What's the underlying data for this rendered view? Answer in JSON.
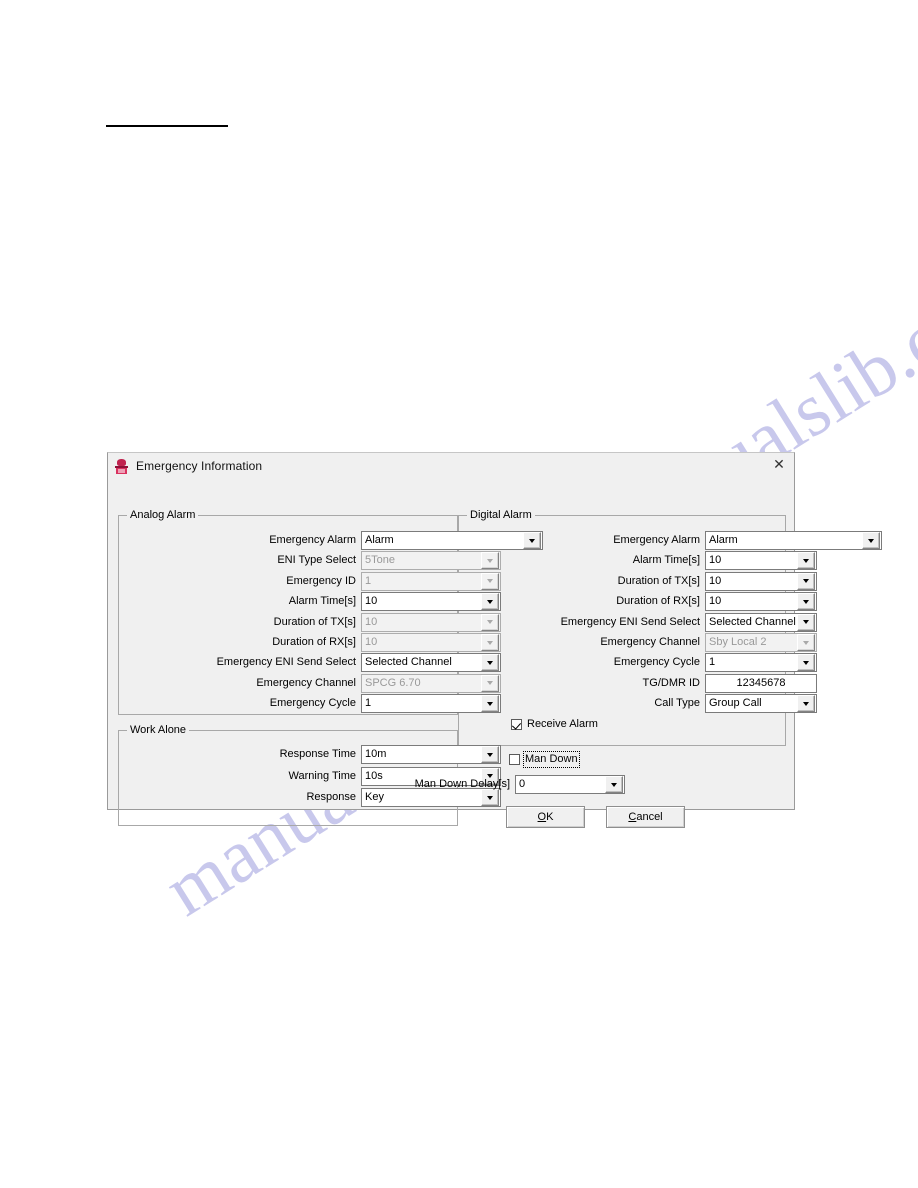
{
  "window": {
    "title": "Emergency Information",
    "icon": "app-icon",
    "close_icon": "close-icon"
  },
  "analog": {
    "group_title": "Analog Alarm",
    "rows": [
      {
        "label": "Emergency Alarm",
        "value": "Alarm",
        "control": "combo",
        "enabled": true,
        "wide": true
      },
      {
        "label": "ENI Type Select",
        "value": "5Tone",
        "control": "combo",
        "enabled": false,
        "wide": false
      },
      {
        "label": "Emergency ID",
        "value": "1",
        "control": "combo",
        "enabled": false,
        "wide": false
      },
      {
        "label": "Alarm Time[s]",
        "value": "10",
        "control": "combo",
        "enabled": true,
        "wide": false
      },
      {
        "label": "Duration of TX[s]",
        "value": "10",
        "control": "combo",
        "enabled": false,
        "wide": false
      },
      {
        "label": "Duration of RX[s]",
        "value": "10",
        "control": "combo",
        "enabled": false,
        "wide": false
      },
      {
        "label": "Emergency ENI Send Select",
        "value": "Selected Channel",
        "control": "combo",
        "enabled": true,
        "wide": false
      },
      {
        "label": "Emergency Channel",
        "value": "SPCG 6.70",
        "control": "combo",
        "enabled": false,
        "wide": false
      },
      {
        "label": "Emergency Cycle",
        "value": "1",
        "control": "combo",
        "enabled": true,
        "wide": false
      }
    ]
  },
  "work_alone": {
    "group_title": "Work Alone",
    "rows": [
      {
        "label": "Response Time",
        "value": "10m",
        "control": "combo",
        "enabled": true,
        "wide": false
      },
      {
        "label": "Warning Time",
        "value": "10s",
        "control": "combo",
        "enabled": true,
        "wide": false
      },
      {
        "label": "Response",
        "value": "Key",
        "control": "combo",
        "enabled": true,
        "wide": false
      }
    ]
  },
  "digital": {
    "group_title": "Digital Alarm",
    "rows": [
      {
        "label": "Emergency Alarm",
        "value": "Alarm",
        "control": "combo",
        "enabled": true,
        "wide": true
      },
      {
        "label": "Alarm Time[s]",
        "value": "10",
        "control": "combo",
        "enabled": true,
        "wide": false
      },
      {
        "label": "Duration of TX[s]",
        "value": "10",
        "control": "combo",
        "enabled": true,
        "wide": false
      },
      {
        "label": "Duration of RX[s]",
        "value": "10",
        "control": "combo",
        "enabled": true,
        "wide": false
      },
      {
        "label": "Emergency ENI Send Select",
        "value": "Selected Channel",
        "control": "combo",
        "enabled": true,
        "wide": false
      },
      {
        "label": "Emergency Channel",
        "value": "Sby Local 2",
        "control": "combo",
        "enabled": false,
        "wide": false
      },
      {
        "label": "Emergency Cycle",
        "value": "1",
        "control": "combo",
        "enabled": true,
        "wide": false
      },
      {
        "label": "TG/DMR ID",
        "value": "12345678",
        "control": "text",
        "enabled": true,
        "wide": false
      },
      {
        "label": "Call Type",
        "value": "Group Call",
        "control": "combo",
        "enabled": true,
        "wide": false
      }
    ],
    "receive_alarm": {
      "label": "Receive Alarm",
      "checked": true,
      "focused": false
    }
  },
  "man_down": {
    "checkbox": {
      "label": "Man Down",
      "checked": false,
      "focused": true
    },
    "delay": {
      "label": "Man Down Delay[s]",
      "value": "0",
      "control": "combo",
      "enabled": true
    }
  },
  "buttons": {
    "ok": {
      "accel": "O",
      "rest": "K"
    },
    "cancel": {
      "accel": "C",
      "rest": "ancel"
    }
  },
  "watermark": {
    "line1": "manualslib.com",
    "line2": "manualslib.com"
  }
}
